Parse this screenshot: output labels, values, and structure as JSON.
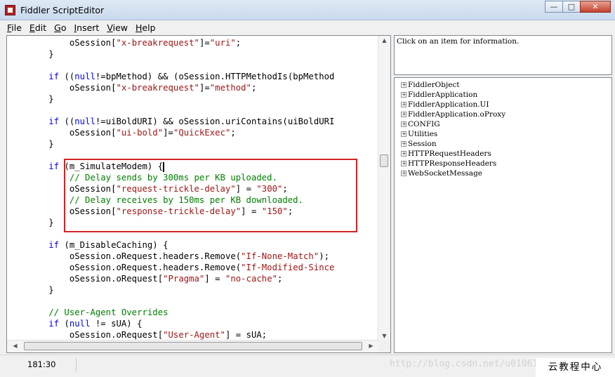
{
  "window": {
    "title": "Fiddler ScriptEditor",
    "controls": {
      "minimize": "—",
      "maximize": "□",
      "close": "✕"
    }
  },
  "menu": [
    {
      "accel": "F",
      "rest": "ile"
    },
    {
      "accel": "E",
      "rest": "dit"
    },
    {
      "accel": "G",
      "rest": "o"
    },
    {
      "accel": "I",
      "rest": "nsert"
    },
    {
      "accel": "V",
      "rest": "iew"
    },
    {
      "accel": "H",
      "rest": "elp"
    }
  ],
  "editor": {
    "lines": [
      [
        {
          "t": "            oSession["
        },
        {
          "t": "\"x-breakrequest\"",
          "c": "str"
        },
        {
          "t": "]="
        },
        {
          "t": "\"uri\"",
          "c": "str"
        },
        {
          "t": ";"
        }
      ],
      [
        {
          "t": "        }"
        }
      ],
      [],
      [
        {
          "t": "        "
        },
        {
          "t": "if",
          "c": "kw"
        },
        {
          "t": " (("
        },
        {
          "t": "null",
          "c": "kw"
        },
        {
          "t": "!=bpMethod) && (oSession.HTTPMethodIs(bpMethod"
        }
      ],
      [
        {
          "t": "            oSession["
        },
        {
          "t": "\"x-breakrequest\"",
          "c": "str"
        },
        {
          "t": "]="
        },
        {
          "t": "\"method\"",
          "c": "str"
        },
        {
          "t": ";"
        }
      ],
      [
        {
          "t": "        }"
        }
      ],
      [],
      [
        {
          "t": "        "
        },
        {
          "t": "if",
          "c": "kw"
        },
        {
          "t": " (("
        },
        {
          "t": "null",
          "c": "kw"
        },
        {
          "t": "!=uiBoldURI) && oSession.uriContains(uiBoldURI"
        }
      ],
      [
        {
          "t": "            oSession["
        },
        {
          "t": "\"ui-bold\"",
          "c": "str"
        },
        {
          "t": "]="
        },
        {
          "t": "\"QuickExec\"",
          "c": "str"
        },
        {
          "t": ";"
        }
      ],
      [
        {
          "t": "        }"
        }
      ],
      [],
      [
        {
          "t": "        "
        },
        {
          "t": "if",
          "c": "kw"
        },
        {
          "t": " (m_SimulateModem) {"
        },
        {
          "cursor": true
        }
      ],
      [
        {
          "t": "            // Delay sends by 300ms per KB uploaded.",
          "c": "cm"
        }
      ],
      [
        {
          "t": "            oSession["
        },
        {
          "t": "\"request-trickle-delay\"",
          "c": "str"
        },
        {
          "t": "] = "
        },
        {
          "t": "\"300\"",
          "c": "str"
        },
        {
          "t": ";"
        }
      ],
      [
        {
          "t": "            // Delay receives by 150ms per KB downloaded.",
          "c": "cm"
        }
      ],
      [
        {
          "t": "            oSession["
        },
        {
          "t": "\"response-trickle-delay\"",
          "c": "str"
        },
        {
          "t": "] = "
        },
        {
          "t": "\"150\"",
          "c": "str"
        },
        {
          "t": ";"
        }
      ],
      [
        {
          "t": "        }"
        }
      ],
      [],
      [
        {
          "t": "        "
        },
        {
          "t": "if",
          "c": "kw"
        },
        {
          "t": " (m_DisableCaching) {"
        }
      ],
      [
        {
          "t": "            oSession.oRequest.headers.Remove("
        },
        {
          "t": "\"If-None-Match\"",
          "c": "str"
        },
        {
          "t": ");"
        }
      ],
      [
        {
          "t": "            oSession.oRequest.headers.Remove("
        },
        {
          "t": "\"If-Modified-Since",
          "c": "str"
        }
      ],
      [
        {
          "t": "            oSession.oRequest["
        },
        {
          "t": "\"Pragma\"",
          "c": "str"
        },
        {
          "t": "] = "
        },
        {
          "t": "\"no-cache\"",
          "c": "str"
        },
        {
          "t": ";"
        }
      ],
      [
        {
          "t": "        }"
        }
      ],
      [],
      [
        {
          "t": "        // User-Agent Overrides",
          "c": "cm"
        }
      ],
      [
        {
          "t": "        "
        },
        {
          "t": "if",
          "c": "kw"
        },
        {
          "t": " ("
        },
        {
          "t": "null",
          "c": "kw"
        },
        {
          "t": " != sUA) {"
        }
      ],
      [
        {
          "t": "            oSession.oRequest["
        },
        {
          "t": "\"User-Agent\"",
          "c": "str"
        },
        {
          "t": "] = sUA;"
        }
      ]
    ]
  },
  "info": {
    "text": "Click on an item for information."
  },
  "tree": {
    "expander": "+",
    "items": [
      "FiddlerObject",
      "FiddlerApplication",
      "FiddlerApplication.UI",
      "FiddlerApplication.oProxy",
      "CONFIG",
      "Utilities",
      "Session",
      "HTTPRequestHeaders",
      "HTTPResponseHeaders",
      "WebSocketMessage"
    ]
  },
  "status": {
    "position": "181:30"
  },
  "watermark": {
    "url": "http://blog.csdn.net/u010618194",
    "badge": "云教程中心"
  }
}
